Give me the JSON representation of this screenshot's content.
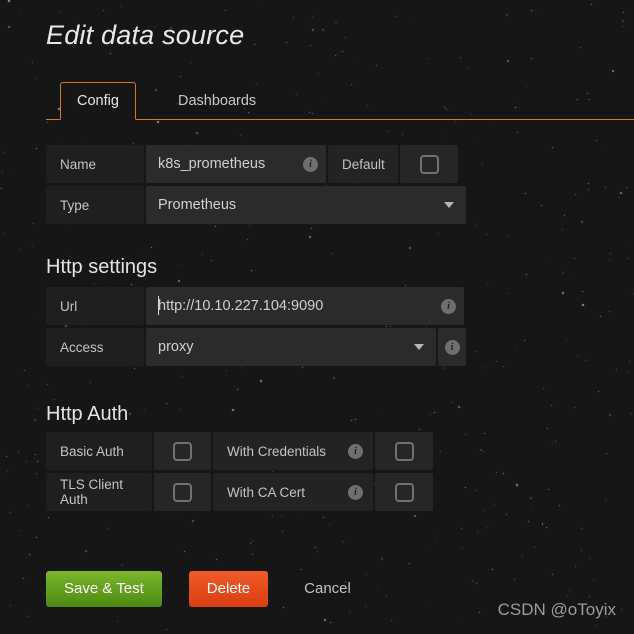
{
  "page": {
    "title": "Edit data source",
    "watermark": "CSDN @oToyix"
  },
  "tabs": [
    {
      "label": "Config",
      "active": true
    },
    {
      "label": "Dashboards",
      "active": false
    }
  ],
  "settings": {
    "name": {
      "label": "Name",
      "value": "k8s_prometheus",
      "info_icon": "info-icon",
      "default_label": "Default",
      "default_checked": false
    },
    "type": {
      "label": "Type",
      "value": "Prometheus",
      "caret_icon": "chevron-down-icon"
    }
  },
  "http_settings": {
    "heading": "Http settings",
    "url": {
      "label": "Url",
      "value": "http://10.10.227.104:9090",
      "info_icon": "info-icon"
    },
    "access": {
      "label": "Access",
      "value": "proxy",
      "caret_icon": "chevron-down-icon",
      "info_icon": "info-icon"
    }
  },
  "http_auth": {
    "heading": "Http Auth",
    "rows": [
      {
        "label": "Basic Auth",
        "checked": false,
        "second_label": "With Credentials",
        "second_info_icon": "info-icon",
        "second_checked": false
      },
      {
        "label": "TLS Client Auth",
        "checked": false,
        "second_label": "With CA Cert",
        "second_info_icon": "info-icon",
        "second_checked": false
      }
    ]
  },
  "actions": {
    "save": "Save & Test",
    "delete": "Delete",
    "cancel": "Cancel"
  },
  "colors": {
    "accent": "#cf7b28",
    "save": "#629e1d",
    "delete": "#e4491a",
    "background": "#171616"
  },
  "icons": {
    "info": "i"
  }
}
